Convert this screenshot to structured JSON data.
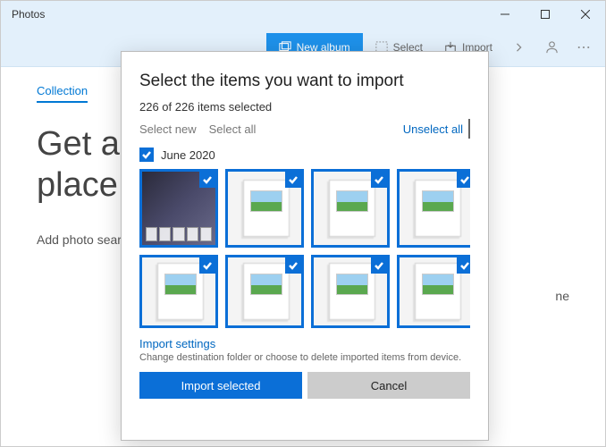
{
  "titlebar": {
    "app_name": "Photos"
  },
  "commandbar": {
    "new_album": "New album",
    "select": "Select",
    "import": "Import"
  },
  "page": {
    "tab": "Collection",
    "hero_line1": "Get a",
    "hero_line2": "place",
    "subtext": "Add photo searchable",
    "right_fragment": "ne"
  },
  "dialog": {
    "title": "Select the items you want to import",
    "count_text": "226 of 226 items selected",
    "select_new": "Select new",
    "select_all": "Select all",
    "unselect_all": "Unselect all",
    "group_label": "June 2020",
    "settings_title": "Import settings",
    "settings_desc": "Change destination folder or choose to delete imported items from device.",
    "import_button": "Import selected",
    "cancel_button": "Cancel"
  }
}
